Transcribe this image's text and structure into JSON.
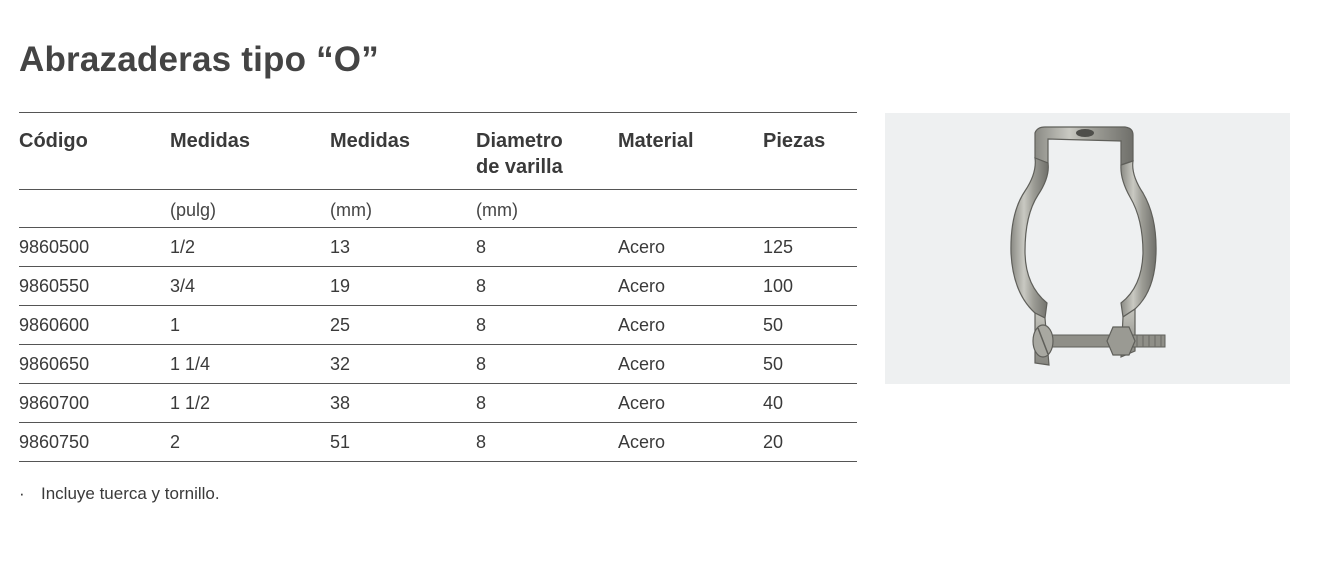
{
  "title": "Abrazaderas tipo “O”",
  "table": {
    "headers": [
      "Código",
      "Medidas",
      "Medidas",
      "Diametro de varilla",
      "Material",
      "Piezas"
    ],
    "units": [
      "",
      "(pulg)",
      "(mm)",
      "(mm)",
      "",
      ""
    ],
    "rows": [
      [
        "9860500",
        "1/2",
        "13",
        "8",
        "Acero",
        "125"
      ],
      [
        "9860550",
        "3/4",
        "19",
        "8",
        "Acero",
        "100"
      ],
      [
        "9860600",
        "1",
        "25",
        "8",
        "Acero",
        "50"
      ],
      [
        "9860650",
        "1 1/4",
        "32",
        "8",
        "Acero",
        "50"
      ],
      [
        "9860700",
        "1 1/2",
        "38",
        "8",
        "Acero",
        "40"
      ],
      [
        "9860750",
        "2",
        "51",
        "8",
        "Acero",
        "20"
      ]
    ]
  },
  "note": {
    "bullet": "·",
    "text": "Incluye tuerca y tornillo."
  },
  "image": {
    "icon": "pipe-clamp-icon",
    "background": "#eef0f1"
  }
}
